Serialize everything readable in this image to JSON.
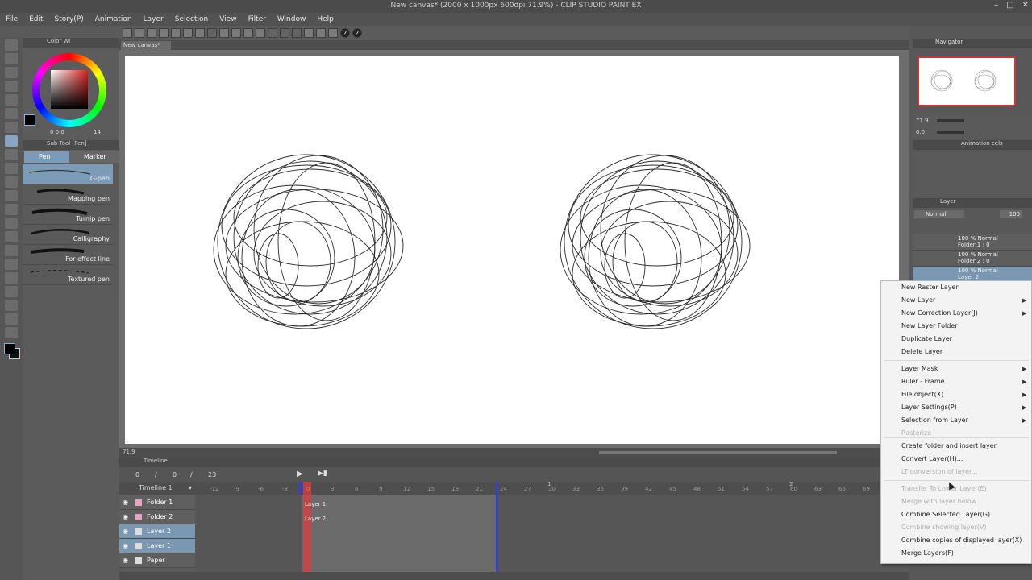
{
  "window": {
    "title": "New canvas* (2000 x 1000px 600dpi 71.9%) - CLIP STUDIO PAINT EX"
  },
  "menu": [
    "File",
    "Edit",
    "Story(P)",
    "Animation",
    "Layer",
    "Selection",
    "View",
    "Filter",
    "Window",
    "Help"
  ],
  "panels": {
    "color_tab": "Color Wi",
    "subtool_tab": "Sub Tool [Pen]",
    "navigator_tab": "Navigator",
    "animation_tab": "Animation cels",
    "layer_tab": "Layer"
  },
  "subtool": {
    "groups": [
      "Pen",
      "Marker"
    ],
    "brushes": [
      "G-pen",
      "Mapping pen",
      "Turnip pen",
      "Calligraphy",
      "For effect line",
      "Textured pen"
    ],
    "selected_brush": "G-pen"
  },
  "color": {
    "values": "0  0  0",
    "extra": "14",
    "main": "#000000",
    "sub": "#2d2d2d"
  },
  "document": {
    "tab": "New canvas*",
    "zoom": "71.9"
  },
  "timeline": {
    "tab": "Timeline",
    "name": "Timeline 1",
    "counters": [
      "0",
      "/",
      "0",
      "/",
      "23"
    ],
    "ruler": [
      "-12",
      "-9",
      "-6",
      "-3",
      "0",
      "3",
      "6",
      "9",
      "12",
      "15",
      "18",
      "21",
      "24",
      "27",
      "30",
      "33",
      "36",
      "39",
      "42",
      "45",
      "48",
      "51",
      "54",
      "57",
      "60",
      "63",
      "66",
      "69"
    ],
    "ruler_secs": [
      "1",
      "2"
    ],
    "rows": [
      {
        "name": "Folder 1",
        "type": "folder",
        "selected": false
      },
      {
        "name": "Folder 2",
        "type": "folder",
        "selected": false
      },
      {
        "name": "Layer 2",
        "type": "layer",
        "selected": true
      },
      {
        "name": "Layer 1",
        "type": "layer",
        "selected": true
      },
      {
        "name": "Paper",
        "type": "paper",
        "selected": false
      }
    ],
    "cels": [
      "Layer 1",
      "Layer 2"
    ]
  },
  "navigator": {
    "zoom": "71.9",
    "angle": "0.0"
  },
  "layers": {
    "blend_mode": "Normal",
    "opacity": "100",
    "items": [
      {
        "line1": "100 %  Normal",
        "line2": "Folder 1 : 0"
      },
      {
        "line1": "100 %  Normal",
        "line2": "Folder 2 : 0"
      },
      {
        "line1": "100 %  Normal",
        "line2": "Layer 2"
      }
    ]
  },
  "context_menu": [
    {
      "label": "New Raster Layer",
      "disabled": false,
      "submenu": false
    },
    {
      "label": "New Layer",
      "disabled": false,
      "submenu": true
    },
    {
      "label": "New Correction Layer(J)",
      "disabled": false,
      "submenu": true
    },
    {
      "label": "New Layer Folder",
      "disabled": false,
      "submenu": false
    },
    {
      "label": "Duplicate Layer",
      "disabled": false,
      "submenu": false
    },
    {
      "label": "Delete Layer",
      "disabled": false,
      "submenu": false
    },
    {
      "label": "Layer Mask",
      "disabled": false,
      "submenu": true
    },
    {
      "label": "Ruler - Frame",
      "disabled": false,
      "submenu": true
    },
    {
      "label": "File object(X)",
      "disabled": false,
      "submenu": true
    },
    {
      "label": "Layer Settings(P)",
      "disabled": false,
      "submenu": true
    },
    {
      "label": "Selection from Layer",
      "disabled": false,
      "submenu": true
    },
    {
      "label": "Rasterize",
      "disabled": true,
      "submenu": false
    },
    {
      "label": "Create folder and insert layer",
      "disabled": false,
      "submenu": false
    },
    {
      "label": "Convert Layer(H)...",
      "disabled": false,
      "submenu": false
    },
    {
      "label": "LT conversion of layer...",
      "disabled": true,
      "submenu": false
    },
    {
      "label": "Transfer To Lower Layer(E)",
      "disabled": true,
      "submenu": false
    },
    {
      "label": "Merge with layer below",
      "disabled": true,
      "submenu": false
    },
    {
      "label": "Combine Selected Layer(G)",
      "disabled": false,
      "submenu": false
    },
    {
      "label": "Combine showing layer(V)",
      "disabled": true,
      "submenu": false
    },
    {
      "label": "Combine copies of displayed layer(X)",
      "disabled": false,
      "submenu": false
    },
    {
      "label": "Merge Layers(F)",
      "disabled": false,
      "submenu": false
    }
  ]
}
